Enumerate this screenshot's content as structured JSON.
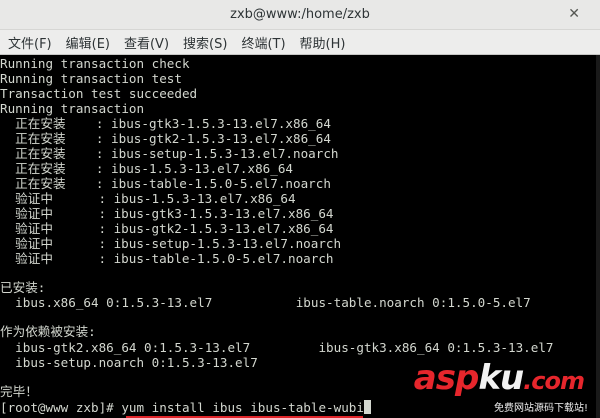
{
  "window": {
    "title": "zxb@www:/home/zxb",
    "close_glyph": "✕"
  },
  "menu": [
    {
      "label": "文件(F)"
    },
    {
      "label": "编辑(E)"
    },
    {
      "label": "查看(V)"
    },
    {
      "label": "搜索(S)"
    },
    {
      "label": "终端(T)"
    },
    {
      "label": "帮助(H)"
    }
  ],
  "terminal": {
    "lines": [
      "Running transaction check",
      "Running transaction test",
      "Transaction test succeeded",
      "Running transaction",
      "  正在安装    : ibus-gtk3-1.5.3-13.el7.x86_64",
      "  正在安装    : ibus-gtk2-1.5.3-13.el7.x86_64",
      "  正在安装    : ibus-setup-1.5.3-13.el7.noarch",
      "  正在安装    : ibus-1.5.3-13.el7.x86_64",
      "  正在安装    : ibus-table-1.5.0-5.el7.noarch",
      "  验证中      : ibus-1.5.3-13.el7.x86_64",
      "  验证中      : ibus-gtk3-1.5.3-13.el7.x86_64",
      "  验证中      : ibus-gtk2-1.5.3-13.el7.x86_64",
      "  验证中      : ibus-setup-1.5.3-13.el7.noarch",
      "  验证中      : ibus-table-1.5.0-5.el7.noarch",
      "",
      "已安装:",
      "  ibus.x86_64 0:1.5.3-13.el7           ibus-table.noarch 0:1.5.0-5.el7",
      "",
      "作为依赖被安装:",
      "  ibus-gtk2.x86_64 0:1.5.3-13.el7         ibus-gtk3.x86_64 0:1.5.3-13.el7",
      "  ibus-setup.noarch 0:1.5.3-13.el7",
      "",
      "完毕！"
    ],
    "prompt": "[root@www zxb]# ",
    "command": "yum install ibus ibus-table-wubi"
  },
  "watermark": {
    "asp": "asp",
    "ku": "ku",
    "net": ".com",
    "subtitle": "免费网站源码下载站!"
  },
  "colors": {
    "terminal_bg": "#000000",
    "terminal_fg": "#d3d7cf",
    "accent_red": "#e0252a"
  }
}
